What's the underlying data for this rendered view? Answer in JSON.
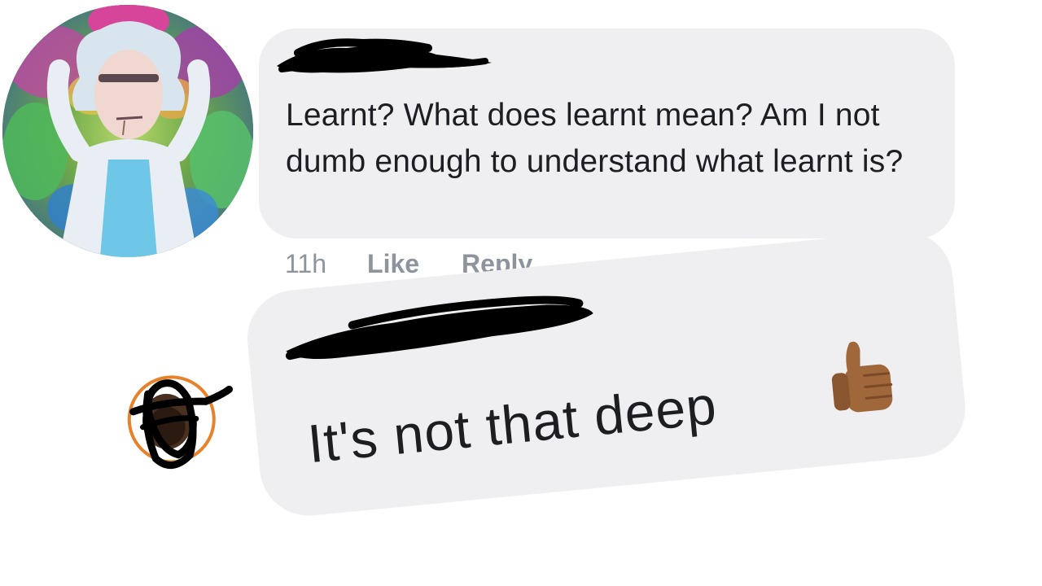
{
  "comments": [
    {
      "author": "",
      "author_redacted": true,
      "avatar_icon": "rick-cartoon-avatar-icon",
      "text": "Learnt? What does learnt mean? Am I not dumb enough to understand what learnt is?",
      "actions": {
        "time": "11h",
        "like_label": "Like",
        "reply_label": "Reply"
      }
    },
    {
      "author": "",
      "author_redacted": true,
      "avatar_icon": "scribbled-out-avatar-icon",
      "text": "It's not that deep",
      "emoji": "thumbs-up-medium-dark-skin-tone-icon"
    }
  ],
  "colors": {
    "bubble_background": "#efeff1",
    "text": "#1c1e21",
    "meta_text": "#8d949e",
    "redaction": "#000000",
    "avatar_ring": "#e8822a",
    "thumb_skin": "#a0683a"
  }
}
